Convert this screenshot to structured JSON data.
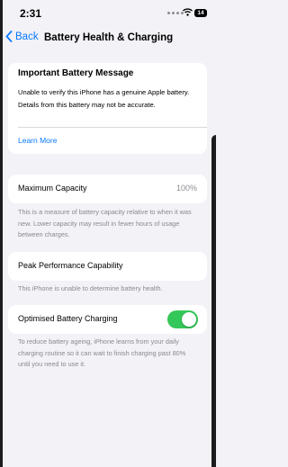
{
  "status_bar": {
    "time": "2:31",
    "battery_level": "14"
  },
  "nav": {
    "back_label": "Back",
    "title": "Battery Health & Charging"
  },
  "alert": {
    "title": "Important Battery Message",
    "body": "Unable to verify this iPhone has a genuine Apple battery. Details from this battery may not be accurate.",
    "link": "Learn More"
  },
  "maximum_capacity": {
    "label": "Maximum Capacity",
    "value": "100%",
    "footnote": "This is a measure of battery capacity relative to when it was new. Lower capacity may result in fewer hours of usage between charges."
  },
  "peak_performance": {
    "label": "Peak Performance Capability",
    "footnote": "This iPhone is unable to determine battery health."
  },
  "optimised_charging": {
    "label": "Optimised Battery Charging",
    "enabled": true,
    "footnote": "To reduce battery ageing, iPhone learns from your daily charging routine so it can wait to finish charging past 80% until you need to use it."
  },
  "colors": {
    "accent": "#0a7aff",
    "toggle_on": "#34c759",
    "background": "#f2f2f7",
    "secondary_text": "#8a8a8e"
  }
}
